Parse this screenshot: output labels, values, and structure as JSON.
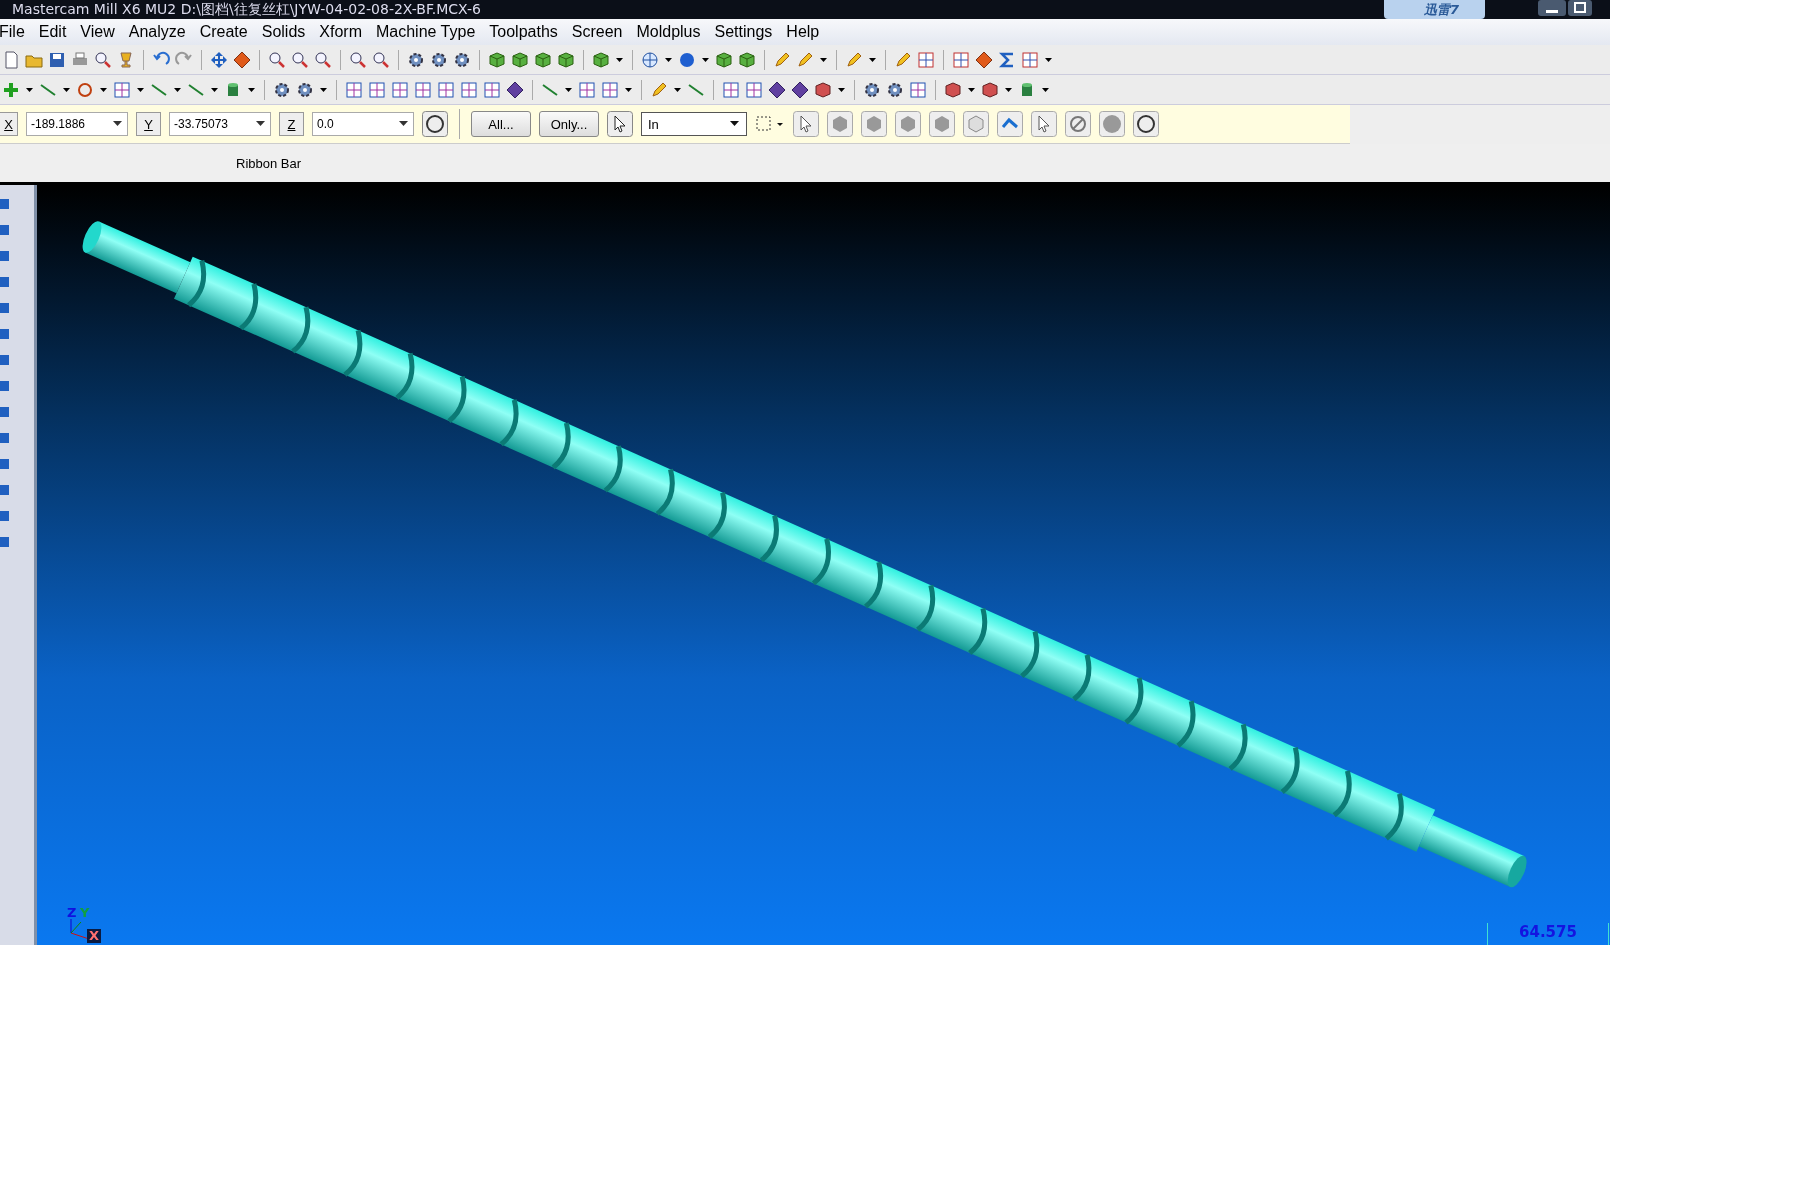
{
  "window": {
    "title": "Mastercam Mill X6 MU2  D:\\图档\\往复丝杠\\JYW-04-02-08-2X-BF.MCX-6",
    "taskbar_badge": "迅雷7"
  },
  "menu": [
    "File",
    "Edit",
    "View",
    "Analyze",
    "Create",
    "Solids",
    "Xform",
    "Machine Type",
    "Toolpaths",
    "Screen",
    "Moldplus",
    "Settings",
    "Help"
  ],
  "coordinates": [
    {
      "label": "X",
      "value": "-189.1886"
    },
    {
      "label": "Y",
      "value": "-33.75073"
    },
    {
      "label": "Z",
      "value": "0.0"
    }
  ],
  "selection_buttons": [
    "All...",
    "Only..."
  ],
  "selection_mode": "In",
  "ribbon_caption": "Ribbon Bar",
  "viewport": {
    "axes": [
      "Z",
      "Y",
      "X"
    ],
    "scale": "64.575"
  }
}
